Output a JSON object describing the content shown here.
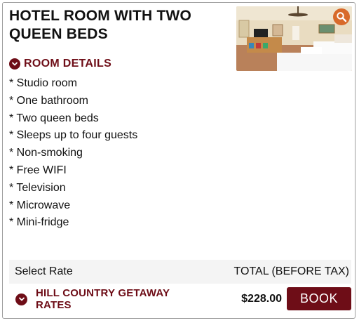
{
  "room": {
    "title": "HOTEL ROOM WITH TWO QUEEN BEDS",
    "image_icon": "zoom-icon",
    "details_label": "ROOM DETAILS",
    "details_icon": "chevron-down-icon",
    "features": [
      "* Studio room",
      "* One bathroom",
      "* Two queen beds",
      "* Sleeps up to four guests",
      "* Non-smoking",
      "* Free WIFI",
      "* Television",
      "* Microwave",
      "* Mini-fridge"
    ]
  },
  "rates": {
    "select_label": "Select Rate",
    "total_label": "TOTAL (BEFORE TAX)",
    "items": [
      {
        "name": "HILL COUNTRY GETAWAY RATES",
        "price": "$228.00",
        "book_label": "BOOK",
        "toggle_icon": "chevron-down-icon"
      }
    ]
  },
  "colors": {
    "accent": "#6e0d17",
    "zoom_badge": "#d86a2a",
    "rate_bar_bg": "#f4f4f4",
    "border": "#9e9e9e"
  }
}
